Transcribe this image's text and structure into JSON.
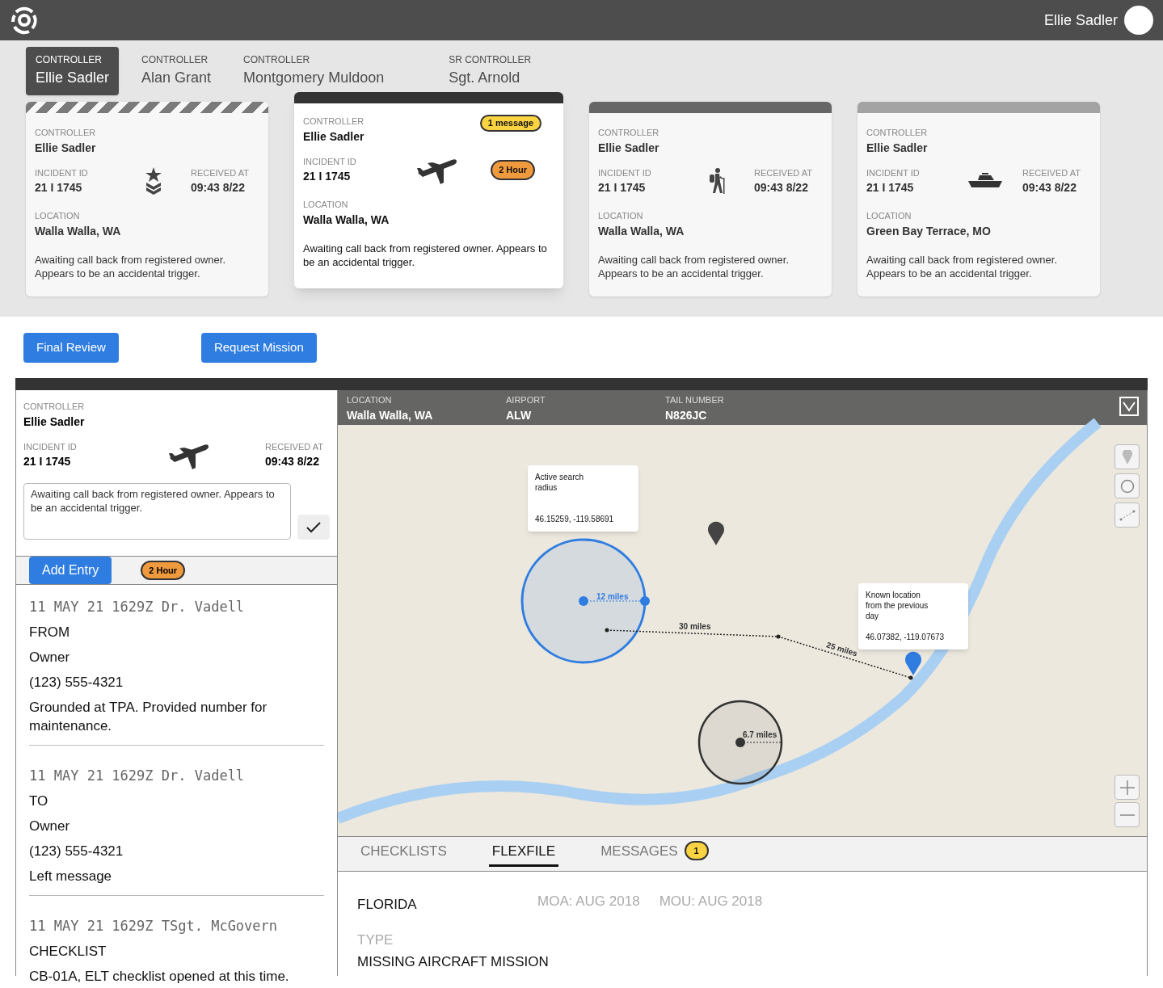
{
  "header": {
    "user_name": "Ellie Sadler"
  },
  "controller_tabs": [
    {
      "role": "CONTROLLER",
      "name": "Ellie Sadler",
      "selected": true
    },
    {
      "role": "CONTROLLER",
      "name": "Alan Grant",
      "selected": false
    },
    {
      "role": "CONTROLLER",
      "name": "Montgomery Muldoon",
      "selected": false
    },
    {
      "role": "SR CONTROLLER",
      "name": "Sgt. Arnold",
      "selected": false
    }
  ],
  "incident_cards": [
    {
      "kind": "military",
      "color": "#7a7a7a",
      "striped": true,
      "selected": false,
      "controller_label": "CONTROLLER",
      "controller": "Ellie Sadler",
      "incident_label": "INCIDENT ID",
      "incident_id": "21 I 1745",
      "received_label": "RECEIVED AT",
      "received": "09:43 8/22",
      "location_label": "LOCATION",
      "location": "Walla Walla, WA",
      "note": "Awaiting call back from registered owner. Appears to be an accidental trigger."
    },
    {
      "kind": "aircraft",
      "color": "#333333",
      "striped": false,
      "selected": true,
      "controller_label": "CONTROLLER",
      "controller": "Ellie Sadler",
      "incident_label": "INCIDENT ID",
      "incident_id": "21 I 1745",
      "message_badge": "1 message",
      "time_badge": "2 Hour",
      "location_label": "LOCATION",
      "location": "Walla Walla, WA",
      "note": "Awaiting call back from registered owner. Appears to be an accidental trigger."
    },
    {
      "kind": "hiker",
      "color": "#666666",
      "striped": false,
      "selected": false,
      "controller_label": "CONTROLLER",
      "controller": "Ellie Sadler",
      "incident_label": "INCIDENT ID",
      "incident_id": "21 I 1745",
      "received_label": "RECEIVED AT",
      "received": "09:43 8/22",
      "location_label": "LOCATION",
      "location": "Walla Walla, WA",
      "note": "Awaiting call back from registered owner. Appears to be an accidental trigger."
    },
    {
      "kind": "boat",
      "color": "#a3a3a3",
      "striped": false,
      "selected": false,
      "controller_label": "CONTROLLER",
      "controller": "Ellie Sadler",
      "incident_label": "INCIDENT ID",
      "incident_id": "21 I 1745",
      "received_label": "RECEIVED AT",
      "received": "09:43 8/22",
      "location_label": "LOCATION",
      "location": "Green Bay Terrace, MO",
      "note": "Awaiting call back from registered owner. Appears to be an accidental trigger."
    }
  ],
  "actions": [
    "Final Review",
    "Request Mission"
  ],
  "detail": {
    "kind": "aircraft",
    "controller_label": "CONTROLLER",
    "controller": "Ellie Sadler",
    "incident_label": "INCIDENT ID",
    "incident_id": "21 I 1745",
    "received_label": "RECEIVED AT",
    "received": "09:43 8/22",
    "note": "Awaiting call back from registered owner. Appears to be an accidental trigger.",
    "add_entry": "Add Entry",
    "time_badge": "2 Hour"
  },
  "log_entries": [
    {
      "header": "11 MAY 21 1629Z Dr. Vadell",
      "lines": [
        "FROM",
        "Owner",
        "(123) 555-4321",
        "Grounded at TPA. Provided number for maintenance."
      ]
    },
    {
      "header": "11 MAY 21 1629Z Dr. Vadell",
      "lines": [
        "TO",
        "Owner",
        "(123) 555-4321",
        "Left message"
      ]
    },
    {
      "header": "11 MAY 21 1629Z TSgt. McGovern",
      "lines": [
        "CHECKLIST",
        "CB-01A, ELT checklist opened at this time."
      ]
    }
  ],
  "map": {
    "info": [
      {
        "label": "LOCATION",
        "value": "Walla Walla, WA"
      },
      {
        "label": "AIRPORT",
        "value": "ALW"
      },
      {
        "label": "TAIL NUMBER",
        "value": "N826JC"
      }
    ],
    "popups": [
      {
        "title": "Active search radius",
        "coords": "46.15259, -119.58691"
      },
      {
        "title": "Known location from the previous day",
        "coords": "46.07382, -119.07673"
      }
    ],
    "distances": [
      "12 miles",
      "30 miles",
      "25 miles",
      "6.7 miles"
    ]
  },
  "file_tabs": [
    {
      "label": "CHECKLISTS",
      "selected": false
    },
    {
      "label": "FLEXFILE",
      "selected": true
    },
    {
      "label": "MESSAGES",
      "selected": false,
      "badge": "1"
    }
  ],
  "flexfile": {
    "state": "FLORIDA",
    "moa": "MOA: AUG 2018",
    "mou": "MOU: AUG 2018",
    "type_label": "TYPE",
    "type": "MISSING AIRCRAFT MISSION"
  }
}
